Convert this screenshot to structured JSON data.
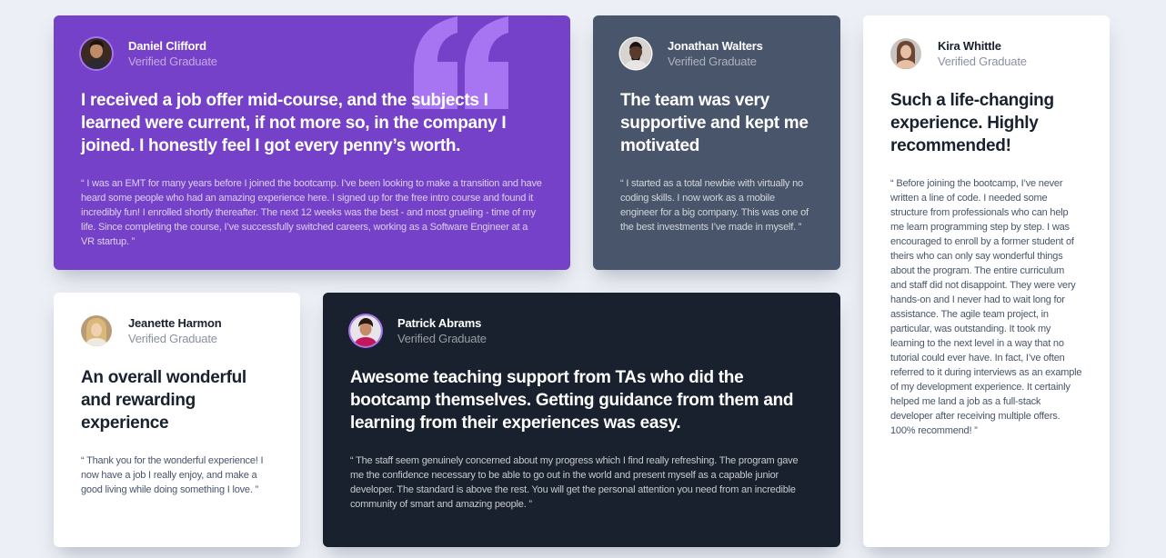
{
  "colors": {
    "background": "#eceff5",
    "purple": "#7541c8",
    "slate": "#48556a",
    "white": "#ffffff",
    "dark": "#19212e",
    "quote_mark": "#a775f1"
  },
  "testimonials": [
    {
      "name": "Daniel Clifford",
      "role": "Verified Graduate",
      "headline": "I received a job offer mid-course, and the subjects I learned were current, if not more so, in the company I joined. I honestly feel I got every penny’s worth.",
      "quote": "“ I was an EMT for many years before I joined the bootcamp. I’ve been looking to make a transition and have heard some people who had an amazing experience here. I signed up for the free intro course and found it incredibly fun! I enrolled shortly thereafter. The next 12 weeks was the best - and most grueling - time of my life. Since completing the course, I’ve successfully switched careers, working as a Software Engineer at a VR startup. ”",
      "theme": "purple",
      "avatar_icon": "avatar-daniel-icon"
    },
    {
      "name": "Jonathan Walters",
      "role": "Verified Graduate",
      "headline": "The team was very supportive and kept me motivated",
      "quote": "“ I started as a total newbie with virtually no coding skills. I now work as a mobile engineer for a big company. This was one of the best investments I’ve made in myself. ”",
      "theme": "slate",
      "avatar_icon": "avatar-jonathan-icon"
    },
    {
      "name": "Kira Whittle",
      "role": "Verified Graduate",
      "headline": "Such a life-changing experience. Highly recommended!",
      "quote": "“ Before joining the bootcamp, I’ve never written a line of code. I needed some structure from professionals who can help me learn programming step by step. I was encouraged to enroll by a former student of theirs who can only say wonderful things about the program. The entire curriculum and staff did not disappoint. They were very hands-on and I never had to wait long for assistance. The agile team project, in particular, was outstanding. It took my learning to the next level in a way that no tutorial could ever have. In fact, I’ve often referred to it during interviews as an example of my development experience. It certainly helped me land a job as a full-stack developer after receiving multiple offers. 100% recommend! ”",
      "theme": "white",
      "avatar_icon": "avatar-kira-icon"
    },
    {
      "name": "Jeanette Harmon",
      "role": "Verified Graduate",
      "headline": "An overall wonderful and rewarding experience",
      "quote": "“ Thank you for the wonderful experience! I now have a job I really enjoy, and make a good living while doing something I love. ”",
      "theme": "white",
      "avatar_icon": "avatar-jeanette-icon"
    },
    {
      "name": "Patrick Abrams",
      "role": "Verified Graduate",
      "headline": "Awesome teaching support from TAs who did the bootcamp themselves. Getting guidance from them and learning from their experiences was easy.",
      "quote": "“ The staff seem genuinely concerned about my progress which I find really refreshing. The program gave me the confidence necessary to be able to go out in the world and present myself as a capable junior developer. The standard is above the rest. You will get the personal attention you need from an incredible community of smart and amazing people. ”",
      "theme": "dark",
      "avatar_icon": "avatar-patrick-icon"
    }
  ]
}
